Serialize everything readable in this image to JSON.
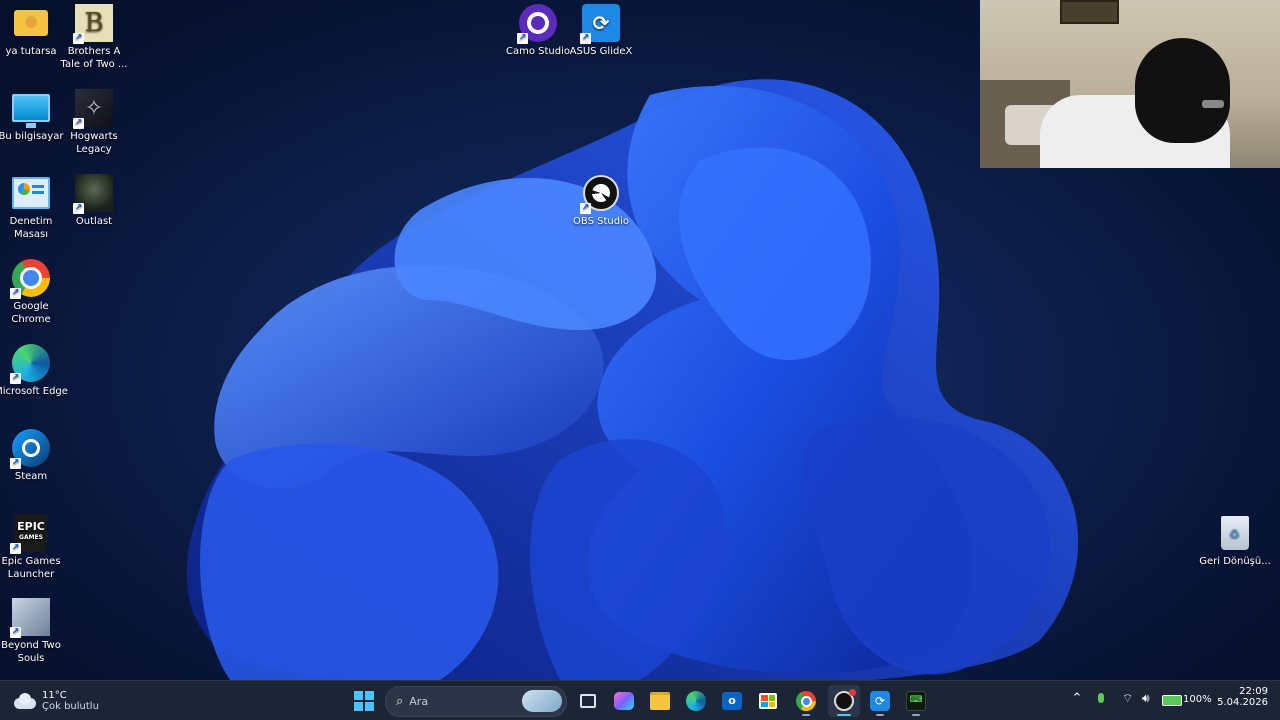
{
  "desktop": {
    "icons": [
      {
        "label": "ya tutarsa"
      },
      {
        "label": "Brothers A Tale of Two ..."
      },
      {
        "label": "Bu bilgisayar"
      },
      {
        "label": "Hogwarts Legacy"
      },
      {
        "label": "Denetim Masası"
      },
      {
        "label": "Outlast"
      },
      {
        "label": "Google Chrome"
      },
      {
        "label": "Microsoft Edge"
      },
      {
        "label": "Steam"
      },
      {
        "label": "Epic Games Launcher"
      },
      {
        "label": "Beyond Two Souls"
      },
      {
        "label": "Camo Studio"
      },
      {
        "label": "ASUS GlideX"
      },
      {
        "label": "OBS Studio"
      },
      {
        "label": "Geri Dönüşü..."
      }
    ]
  },
  "taskbar": {
    "weather": {
      "temp": "11°C",
      "desc": "Çok bulutlu"
    },
    "search_placeholder": "Ara",
    "tray": {
      "battery": "100%",
      "time": "22:09",
      "date": "5.04.2026"
    },
    "epic_logo": "EPIC",
    "epic_sub": "GAMES"
  },
  "colors": {
    "accent": "#1a5fd0",
    "taskbar_bg": "#1c2536"
  }
}
